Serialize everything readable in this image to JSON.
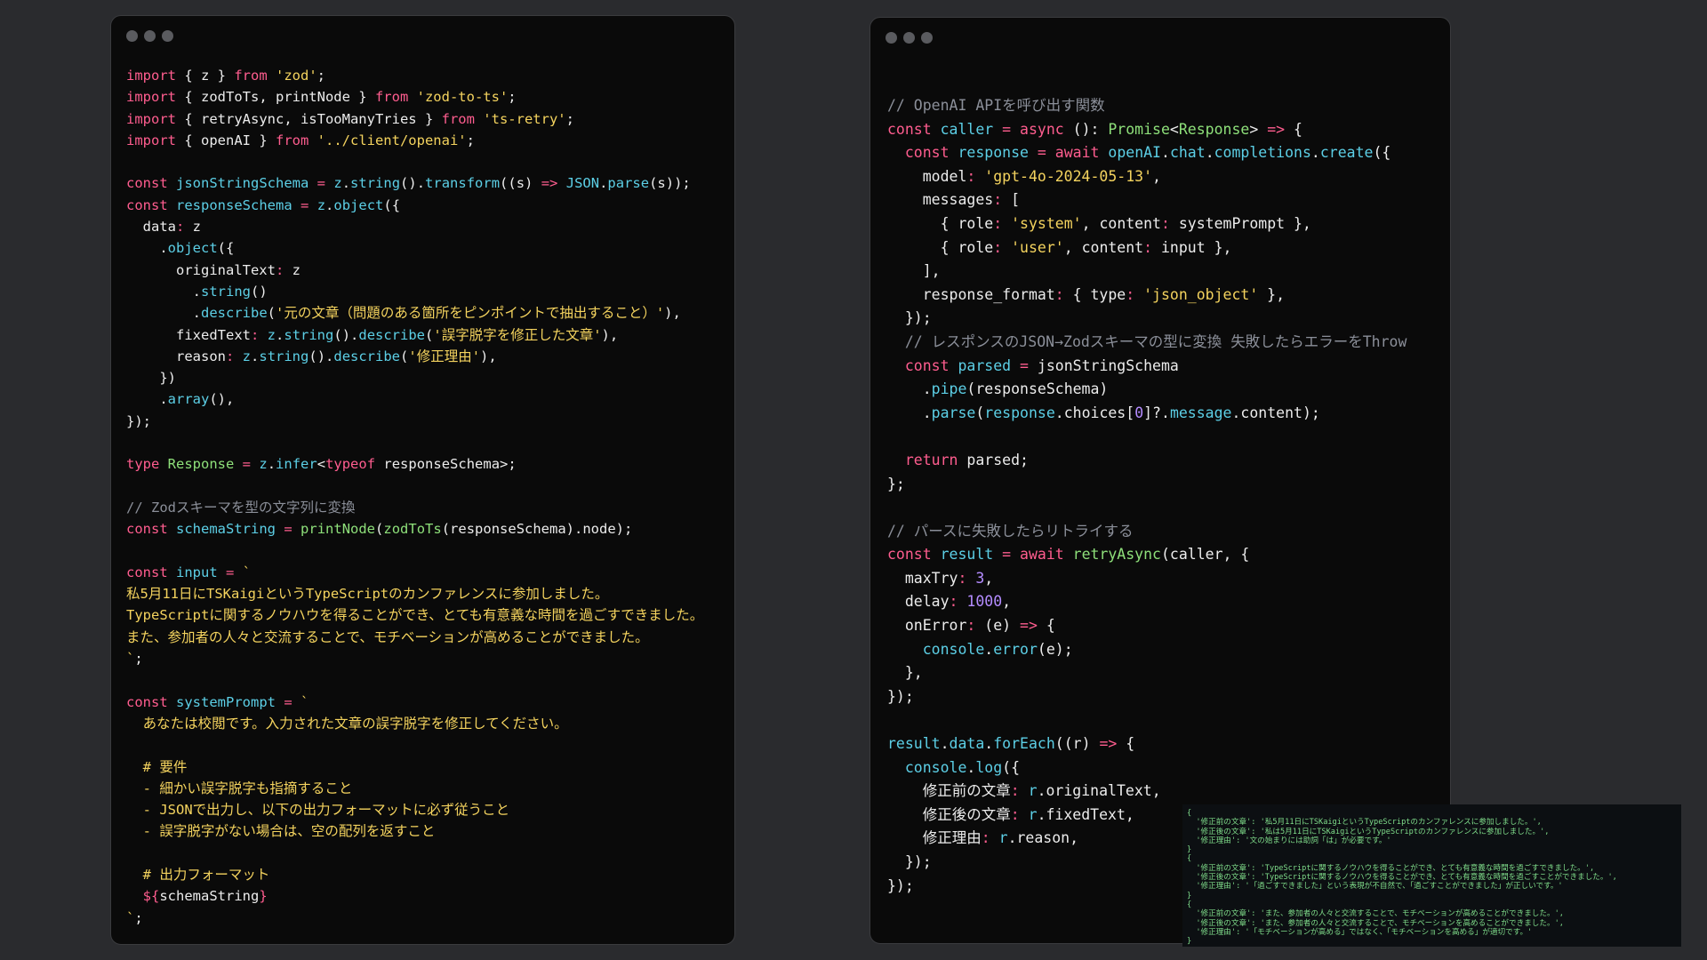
{
  "left_window": {
    "code_lines": [
      [
        [
          "kw",
          "import"
        ],
        [
          "plain",
          " { z } "
        ],
        [
          "kw",
          "from"
        ],
        [
          "plain",
          " "
        ],
        [
          "str",
          "'zod'"
        ],
        [
          "plain",
          ";"
        ]
      ],
      [
        [
          "kw",
          "import"
        ],
        [
          "plain",
          " { zodToTs, printNode } "
        ],
        [
          "kw",
          "from"
        ],
        [
          "plain",
          " "
        ],
        [
          "str",
          "'zod-to-ts'"
        ],
        [
          "plain",
          ";"
        ]
      ],
      [
        [
          "kw",
          "import"
        ],
        [
          "plain",
          " { retryAsync, isTooManyTries } "
        ],
        [
          "kw",
          "from"
        ],
        [
          "plain",
          " "
        ],
        [
          "str",
          "'ts-retry'"
        ],
        [
          "plain",
          ";"
        ]
      ],
      [
        [
          "kw",
          "import"
        ],
        [
          "plain",
          " { openAI } "
        ],
        [
          "kw",
          "from"
        ],
        [
          "plain",
          " "
        ],
        [
          "str",
          "'../client/openai'"
        ],
        [
          "plain",
          ";"
        ]
      ],
      [],
      [
        [
          "kw",
          "const"
        ],
        [
          "plain",
          " "
        ],
        [
          "fn",
          "jsonStringSchema"
        ],
        [
          "plain",
          " "
        ],
        [
          "kw",
          "="
        ],
        [
          "plain",
          " "
        ],
        [
          "fn",
          "z"
        ],
        [
          "plain",
          "."
        ],
        [
          "fn",
          "string"
        ],
        [
          "plain",
          "()."
        ],
        [
          "fn",
          "transform"
        ],
        [
          "plain",
          "((s) "
        ],
        [
          "kw",
          "=>"
        ],
        [
          "plain",
          " "
        ],
        [
          "fn",
          "JSON"
        ],
        [
          "plain",
          "."
        ],
        [
          "fn",
          "parse"
        ],
        [
          "plain",
          "(s));"
        ]
      ],
      [
        [
          "kw",
          "const"
        ],
        [
          "plain",
          " "
        ],
        [
          "fn",
          "responseSchema"
        ],
        [
          "plain",
          " "
        ],
        [
          "kw",
          "="
        ],
        [
          "plain",
          " "
        ],
        [
          "fn",
          "z"
        ],
        [
          "plain",
          "."
        ],
        [
          "fn",
          "object"
        ],
        [
          "plain",
          "({"
        ]
      ],
      [
        [
          "plain",
          "  data"
        ],
        [
          "kw",
          ":"
        ],
        [
          "plain",
          " z"
        ]
      ],
      [
        [
          "plain",
          "    ."
        ],
        [
          "fn",
          "object"
        ],
        [
          "plain",
          "({"
        ]
      ],
      [
        [
          "plain",
          "      originalText"
        ],
        [
          "kw",
          ":"
        ],
        [
          "plain",
          " z"
        ]
      ],
      [
        [
          "plain",
          "        ."
        ],
        [
          "fn",
          "string"
        ],
        [
          "plain",
          "()"
        ]
      ],
      [
        [
          "plain",
          "        ."
        ],
        [
          "fn",
          "describe"
        ],
        [
          "plain",
          "("
        ],
        [
          "str",
          "'元の文章（問題のある箇所をピンポイントで抽出すること）'"
        ],
        [
          "plain",
          "),"
        ]
      ],
      [
        [
          "plain",
          "      fixedText"
        ],
        [
          "kw",
          ":"
        ],
        [
          "plain",
          " "
        ],
        [
          "fn",
          "z"
        ],
        [
          "plain",
          "."
        ],
        [
          "fn",
          "string"
        ],
        [
          "plain",
          "()."
        ],
        [
          "fn",
          "describe"
        ],
        [
          "plain",
          "("
        ],
        [
          "str",
          "'誤字脱字を修正した文章'"
        ],
        [
          "plain",
          "),"
        ]
      ],
      [
        [
          "plain",
          "      reason"
        ],
        [
          "kw",
          ":"
        ],
        [
          "plain",
          " "
        ],
        [
          "fn",
          "z"
        ],
        [
          "plain",
          "."
        ],
        [
          "fn",
          "string"
        ],
        [
          "plain",
          "()."
        ],
        [
          "fn",
          "describe"
        ],
        [
          "plain",
          "("
        ],
        [
          "str",
          "'修正理由'"
        ],
        [
          "plain",
          "),"
        ]
      ],
      [
        [
          "plain",
          "    })"
        ]
      ],
      [
        [
          "plain",
          "    ."
        ],
        [
          "fn",
          "array"
        ],
        [
          "plain",
          "(),"
        ]
      ],
      [
        [
          "plain",
          "});"
        ]
      ],
      [],
      [
        [
          "kw",
          "type"
        ],
        [
          "plain",
          " "
        ],
        [
          "ty",
          "Response"
        ],
        [
          "plain",
          " "
        ],
        [
          "kw",
          "="
        ],
        [
          "plain",
          " "
        ],
        [
          "fn",
          "z"
        ],
        [
          "plain",
          "."
        ],
        [
          "fn",
          "infer"
        ],
        [
          "plain",
          "<"
        ],
        [
          "kw",
          "typeof"
        ],
        [
          "plain",
          " responseSchema>;"
        ]
      ],
      [],
      [
        [
          "com",
          "// Zodスキーマを型の文字列に変換"
        ]
      ],
      [
        [
          "kw",
          "const"
        ],
        [
          "plain",
          " "
        ],
        [
          "fn",
          "schemaString"
        ],
        [
          "plain",
          " "
        ],
        [
          "kw",
          "="
        ],
        [
          "plain",
          " "
        ],
        [
          "ty",
          "printNode"
        ],
        [
          "plain",
          "("
        ],
        [
          "ty",
          "zodToTs"
        ],
        [
          "plain",
          "(responseSchema).node);"
        ]
      ],
      [],
      [
        [
          "kw",
          "const"
        ],
        [
          "plain",
          " "
        ],
        [
          "fn",
          "input"
        ],
        [
          "plain",
          " "
        ],
        [
          "kw",
          "="
        ],
        [
          "plain",
          " "
        ],
        [
          "str",
          "`"
        ]
      ],
      [
        [
          "str",
          "私5月11日にTSKaigiというTypeScriptのカンファレンスに参加しました。"
        ]
      ],
      [
        [
          "str",
          "TypeScriptに関するノウハウを得ることができ、とても有意義な時間を過ごすできました。"
        ]
      ],
      [
        [
          "str",
          "また、参加者の人々と交流することで、モチベーションが高めることができました。"
        ]
      ],
      [
        [
          "str",
          "`"
        ],
        [
          "plain",
          ";"
        ]
      ],
      [],
      [
        [
          "kw",
          "const"
        ],
        [
          "plain",
          " "
        ],
        [
          "fn",
          "systemPrompt"
        ],
        [
          "plain",
          " "
        ],
        [
          "kw",
          "="
        ],
        [
          "plain",
          " "
        ],
        [
          "str",
          "`"
        ]
      ],
      [
        [
          "str",
          "  あなたは校閲です。入力された文章の誤字脱字を修正してください。"
        ]
      ],
      [],
      [
        [
          "str",
          "  # 要件"
        ]
      ],
      [
        [
          "str",
          "  - 細かい誤字脱字も指摘すること"
        ]
      ],
      [
        [
          "str",
          "  - JSONで出力し、以下の出力フォーマットに必ず従うこと"
        ]
      ],
      [
        [
          "str",
          "  - 誤字脱字がない場合は、空の配列を返すこと"
        ]
      ],
      [],
      [
        [
          "str",
          "  # 出力フォーマット"
        ]
      ],
      [
        [
          "kw",
          "  ${"
        ],
        [
          "plain",
          "schemaString"
        ],
        [
          "kw",
          "}"
        ]
      ],
      [
        [
          "str",
          "`"
        ],
        [
          "plain",
          ";"
        ]
      ]
    ]
  },
  "right_window": {
    "code_lines": [
      [
        [
          "com",
          "// OpenAI APIを呼び出す関数"
        ]
      ],
      [
        [
          "kw",
          "const"
        ],
        [
          "plain",
          " "
        ],
        [
          "fn",
          "caller"
        ],
        [
          "plain",
          " "
        ],
        [
          "kw",
          "="
        ],
        [
          "plain",
          " "
        ],
        [
          "kw",
          "async"
        ],
        [
          "plain",
          " (): "
        ],
        [
          "ty",
          "Promise"
        ],
        [
          "plain",
          "<"
        ],
        [
          "ty",
          "Response"
        ],
        [
          "plain",
          "> "
        ],
        [
          "kw",
          "=>"
        ],
        [
          "plain",
          " {"
        ]
      ],
      [
        [
          "plain",
          "  "
        ],
        [
          "kw",
          "const"
        ],
        [
          "plain",
          " "
        ],
        [
          "fn",
          "response"
        ],
        [
          "plain",
          " "
        ],
        [
          "kw",
          "="
        ],
        [
          "plain",
          " "
        ],
        [
          "kw",
          "await"
        ],
        [
          "plain",
          " "
        ],
        [
          "fn",
          "openAI"
        ],
        [
          "plain",
          "."
        ],
        [
          "fn",
          "chat"
        ],
        [
          "plain",
          "."
        ],
        [
          "fn",
          "completions"
        ],
        [
          "plain",
          "."
        ],
        [
          "fn",
          "create"
        ],
        [
          "plain",
          "({"
        ]
      ],
      [
        [
          "plain",
          "    model"
        ],
        [
          "kw",
          ":"
        ],
        [
          "plain",
          " "
        ],
        [
          "str",
          "'gpt-4o-2024-05-13'"
        ],
        [
          "plain",
          ","
        ]
      ],
      [
        [
          "plain",
          "    messages"
        ],
        [
          "kw",
          ":"
        ],
        [
          "plain",
          " ["
        ]
      ],
      [
        [
          "plain",
          "      { role"
        ],
        [
          "kw",
          ":"
        ],
        [
          "plain",
          " "
        ],
        [
          "str",
          "'system'"
        ],
        [
          "plain",
          ", content"
        ],
        [
          "kw",
          ":"
        ],
        [
          "plain",
          " systemPrompt },"
        ]
      ],
      [
        [
          "plain",
          "      { role"
        ],
        [
          "kw",
          ":"
        ],
        [
          "plain",
          " "
        ],
        [
          "str",
          "'user'"
        ],
        [
          "plain",
          ", content"
        ],
        [
          "kw",
          ":"
        ],
        [
          "plain",
          " input },"
        ]
      ],
      [
        [
          "plain",
          "    ],"
        ]
      ],
      [
        [
          "plain",
          "    response_format"
        ],
        [
          "kw",
          ":"
        ],
        [
          "plain",
          " { type"
        ],
        [
          "kw",
          ":"
        ],
        [
          "plain",
          " "
        ],
        [
          "str",
          "'json_object'"
        ],
        [
          "plain",
          " },"
        ]
      ],
      [
        [
          "plain",
          "  });"
        ]
      ],
      [
        [
          "com",
          "  // レスポンスのJSON→Zodスキーマの型に変換 失敗したらエラーをThrow"
        ]
      ],
      [
        [
          "plain",
          "  "
        ],
        [
          "kw",
          "const"
        ],
        [
          "plain",
          " "
        ],
        [
          "fn",
          "parsed"
        ],
        [
          "plain",
          " "
        ],
        [
          "kw",
          "="
        ],
        [
          "plain",
          " jsonStringSchema"
        ]
      ],
      [
        [
          "plain",
          "    ."
        ],
        [
          "fn",
          "pipe"
        ],
        [
          "plain",
          "(responseSchema)"
        ]
      ],
      [
        [
          "plain",
          "    ."
        ],
        [
          "fn",
          "parse"
        ],
        [
          "plain",
          "("
        ],
        [
          "fn",
          "response"
        ],
        [
          "plain",
          "."
        ],
        [
          "plain",
          "choices["
        ],
        [
          "num",
          "0"
        ],
        [
          "plain",
          "]?."
        ],
        [
          "fn",
          "message"
        ],
        [
          "plain",
          ".content);"
        ]
      ],
      [],
      [
        [
          "plain",
          "  "
        ],
        [
          "kw",
          "return"
        ],
        [
          "plain",
          " parsed;"
        ]
      ],
      [
        [
          "plain",
          "};"
        ]
      ],
      [],
      [
        [
          "com",
          "// パースに失敗したらリトライする"
        ]
      ],
      [
        [
          "kw",
          "const"
        ],
        [
          "plain",
          " "
        ],
        [
          "fn",
          "result"
        ],
        [
          "plain",
          " "
        ],
        [
          "kw",
          "="
        ],
        [
          "plain",
          " "
        ],
        [
          "kw",
          "await"
        ],
        [
          "plain",
          " "
        ],
        [
          "ty",
          "retryAsync"
        ],
        [
          "plain",
          "(caller, {"
        ]
      ],
      [
        [
          "plain",
          "  maxTry"
        ],
        [
          "kw",
          ":"
        ],
        [
          "plain",
          " "
        ],
        [
          "num",
          "3"
        ],
        [
          "plain",
          ","
        ]
      ],
      [
        [
          "plain",
          "  delay"
        ],
        [
          "kw",
          ":"
        ],
        [
          "plain",
          " "
        ],
        [
          "num",
          "1000"
        ],
        [
          "plain",
          ","
        ]
      ],
      [
        [
          "plain",
          "  onError"
        ],
        [
          "kw",
          ":"
        ],
        [
          "plain",
          " (e) "
        ],
        [
          "kw",
          "=>"
        ],
        [
          "plain",
          " {"
        ]
      ],
      [
        [
          "plain",
          "    "
        ],
        [
          "fn",
          "console"
        ],
        [
          "plain",
          "."
        ],
        [
          "fn",
          "error"
        ],
        [
          "plain",
          "(e);"
        ]
      ],
      [
        [
          "plain",
          "  },"
        ]
      ],
      [
        [
          "plain",
          "});"
        ]
      ],
      [],
      [
        [
          "fn",
          "result"
        ],
        [
          "plain",
          "."
        ],
        [
          "fn",
          "data"
        ],
        [
          "plain",
          "."
        ],
        [
          "fn",
          "forEach"
        ],
        [
          "plain",
          "((r) "
        ],
        [
          "kw",
          "=>"
        ],
        [
          "plain",
          " {"
        ]
      ],
      [
        [
          "plain",
          "  "
        ],
        [
          "fn",
          "console"
        ],
        [
          "plain",
          "."
        ],
        [
          "fn",
          "log"
        ],
        [
          "plain",
          "({"
        ]
      ],
      [
        [
          "plain",
          "    修正前の文章"
        ],
        [
          "kw",
          ":"
        ],
        [
          "plain",
          " "
        ],
        [
          "fn",
          "r"
        ],
        [
          "plain",
          ".originalText,"
        ]
      ],
      [
        [
          "plain",
          "    修正後の文章"
        ],
        [
          "kw",
          ":"
        ],
        [
          "plain",
          " "
        ],
        [
          "fn",
          "r"
        ],
        [
          "plain",
          ".fixedText,"
        ]
      ],
      [
        [
          "plain",
          "    修正理由"
        ],
        [
          "kw",
          ":"
        ],
        [
          "plain",
          " "
        ],
        [
          "fn",
          "r"
        ],
        [
          "plain",
          ".reason,"
        ]
      ],
      [
        [
          "plain",
          "  });"
        ]
      ],
      [
        [
          "plain",
          "});"
        ]
      ]
    ]
  },
  "console_output": {
    "lines": [
      "{",
      "  '修正前の文章': '私5月11日にTSKaigiというTypeScriptのカンファレンスに参加しました。',",
      "  '修正後の文章': '私は5月11日にTSKaigiというTypeScriptのカンファレンスに参加しました。',",
      "  '修正理由': '文の始まりには助詞「は」が必要です。'",
      "}",
      "{",
      "  '修正前の文章': 'TypeScriptに関するノウハウを得ることができ、とても有意義な時間を過ごすできました。',",
      "  '修正後の文章': 'TypeScriptに関するノウハウを得ることができ、とても有意義な時間を過ごすことができました。',",
      "  '修正理由': '「過ごすできました」という表現が不自然で、「過ごすことができました」が正しいです。'",
      "}",
      "{",
      "  '修正前の文章': 'また、参加者の人々と交流することで、モチベーションが高めることができました。',",
      "  '修正後の文章': 'また、参加者の人々と交流することで、モチベーションを高めることができました。',",
      "  '修正理由': '「モチベーションが高める」ではなく、「モチベーションを高める」が適切です。'",
      "}"
    ]
  },
  "colors": {
    "background": "#2a2b2e",
    "window_bg": "#0a0a0a",
    "keyword": "#ff5d8f",
    "string": "#f4d35e",
    "type": "#8ee07a",
    "function": "#5ccfe6",
    "number": "#b48cff",
    "comment": "#8b8f99",
    "console_text": "#7fdc8a"
  }
}
